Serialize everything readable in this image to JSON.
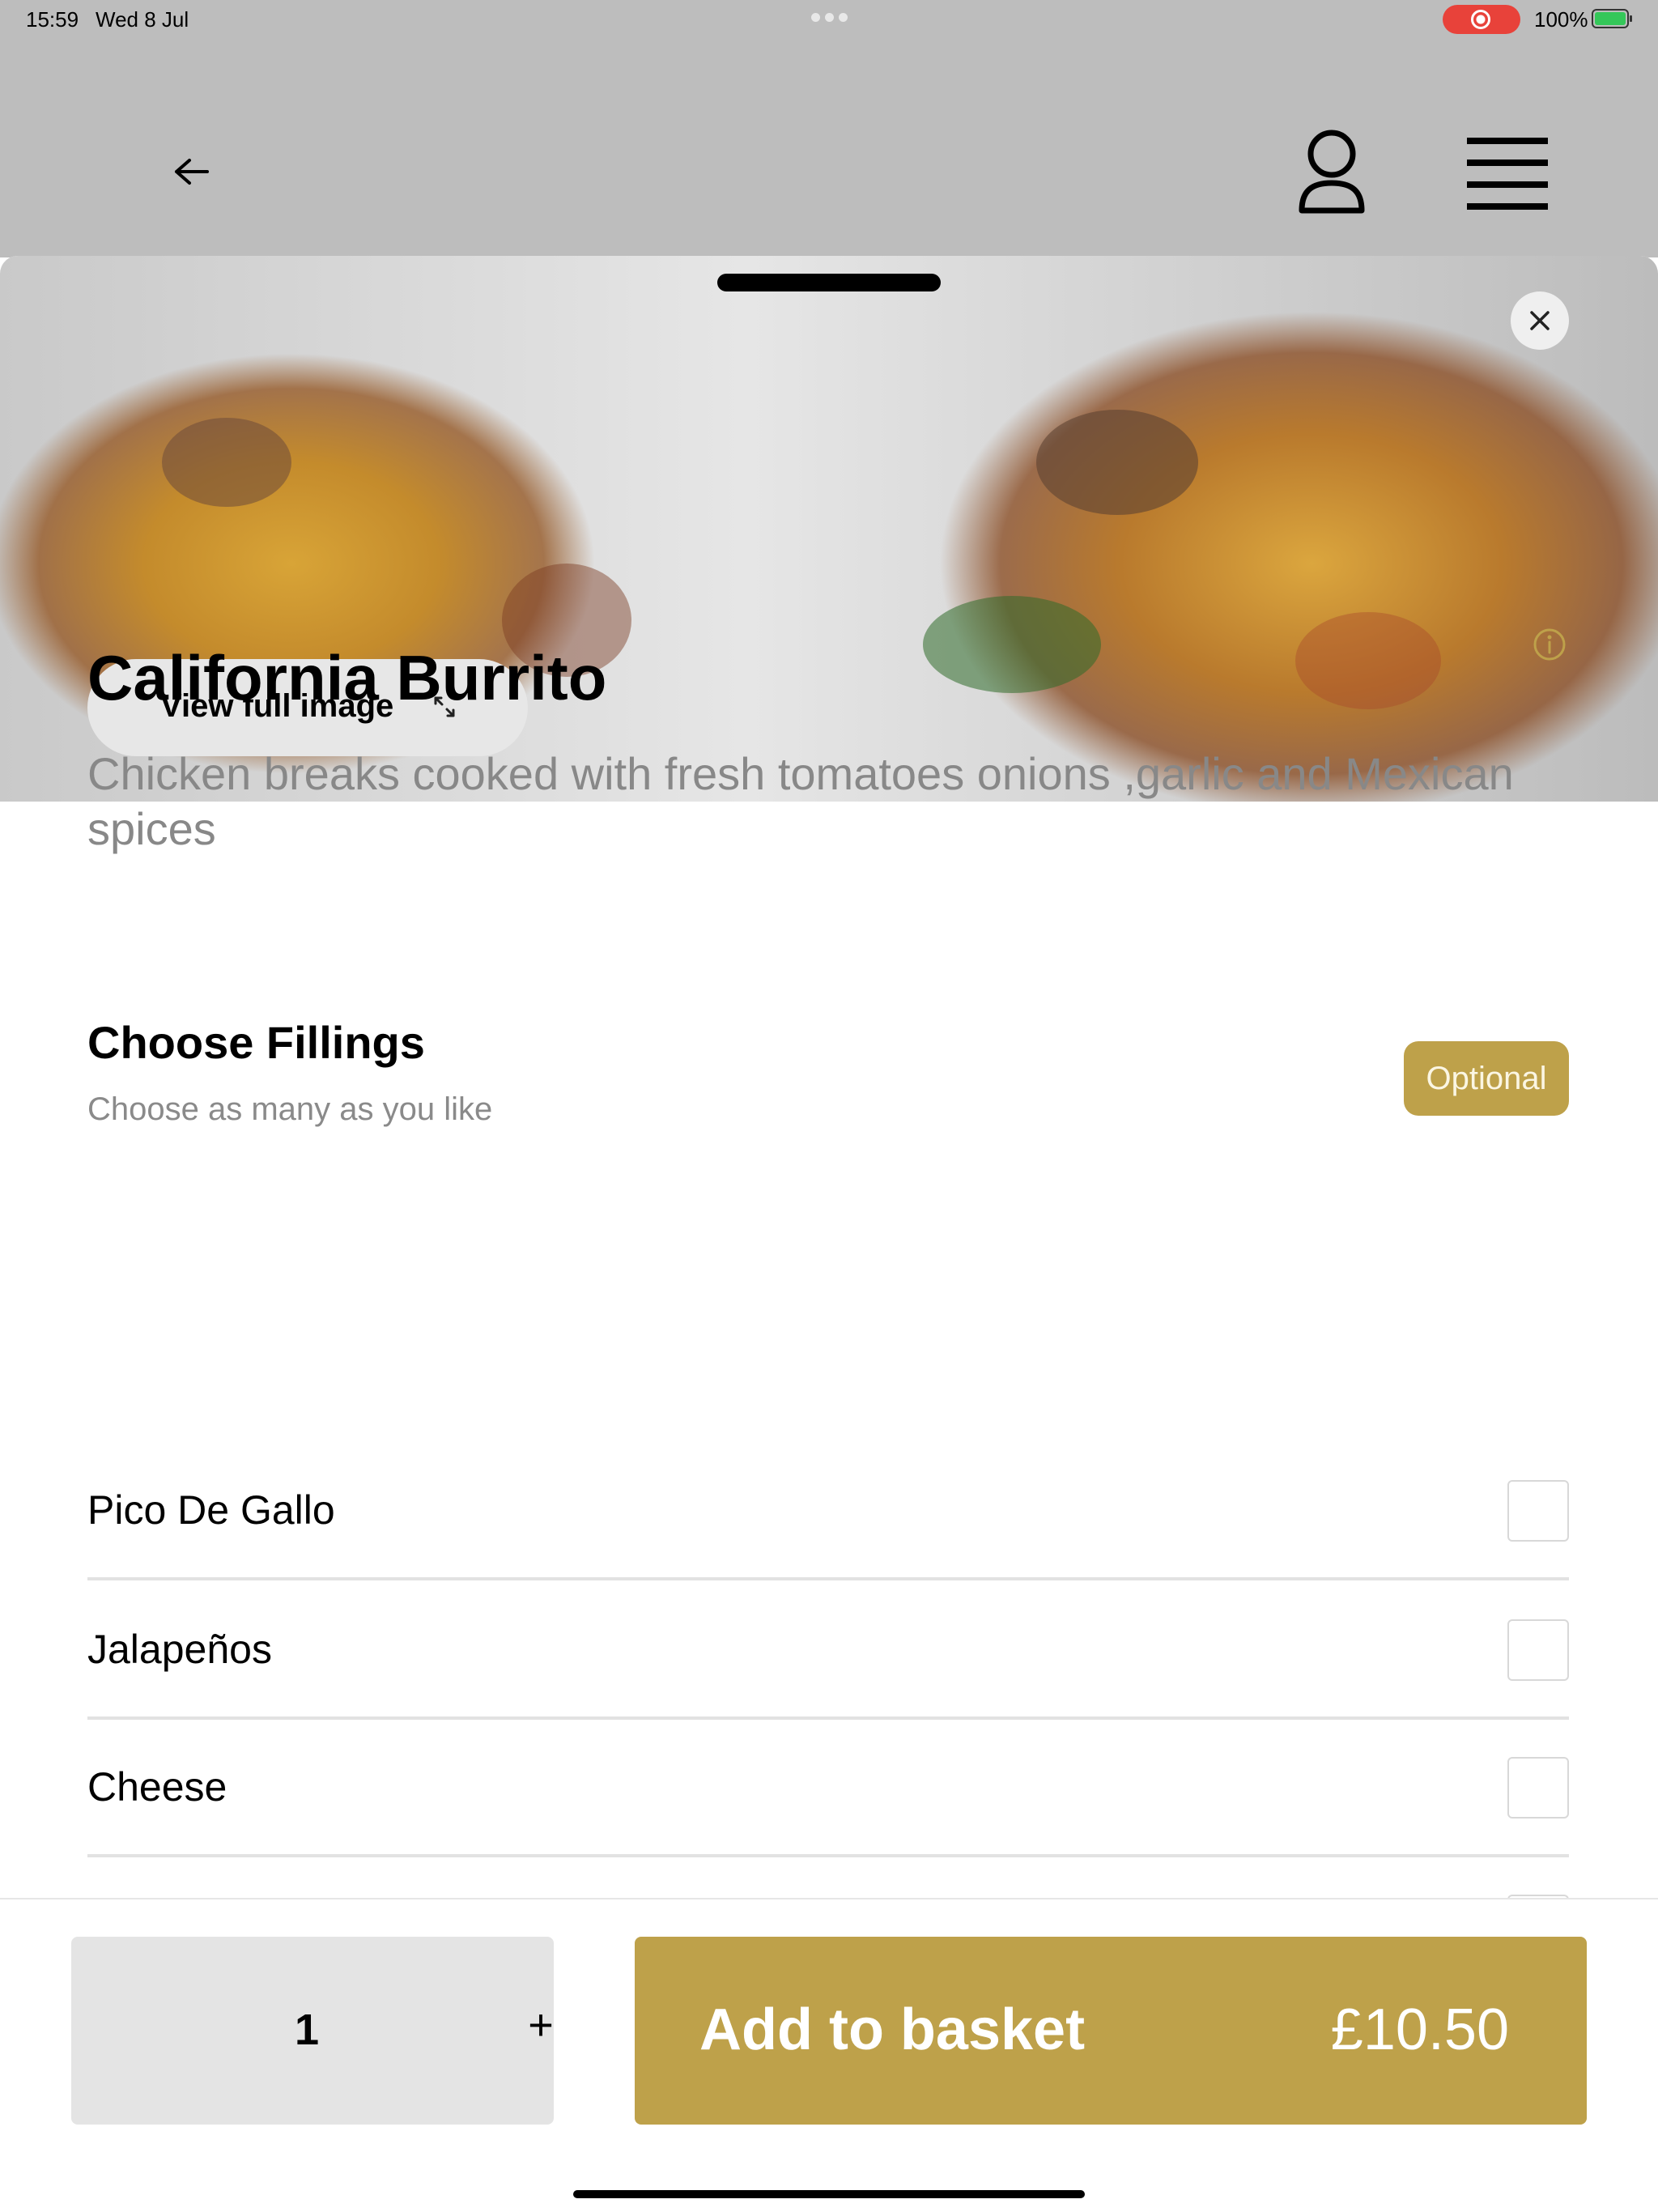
{
  "status_bar": {
    "time": "15:59",
    "date": "Wed 8 Jul",
    "battery_percent": "100%",
    "recording_indicator_color": "#e8423a"
  },
  "nav": {
    "back_icon": "arrow-left-icon",
    "account_icon": "user-icon",
    "menu_icon": "hamburger-menu-icon"
  },
  "hero": {
    "view_full_image_label": "View full image",
    "expand_icon": "expand-arrows-icon",
    "close_icon": "close-icon"
  },
  "item": {
    "title": "California Burrito",
    "description": "Chicken breaks cooked with fresh tomatoes onions ,garlic and Mexican spices",
    "info_icon": "info-icon"
  },
  "fillings": {
    "title": "Choose Fillings",
    "subtitle": "Choose as many as you like",
    "badge": "Optional",
    "options": [
      {
        "label": "Pico De Gallo",
        "checked": false
      },
      {
        "label": "Jalapeños",
        "checked": false
      },
      {
        "label": "Cheese",
        "checked": false
      }
    ]
  },
  "footer": {
    "quantity": "1",
    "plus_label": "+",
    "add_to_basket_label": "Add to basket",
    "price": "£10.50"
  },
  "colors": {
    "accent_gold": "#bea14a",
    "dim_overlay": "#bdbdbd",
    "quantity_bg": "#e4e4e4",
    "description_text": "#888888"
  }
}
